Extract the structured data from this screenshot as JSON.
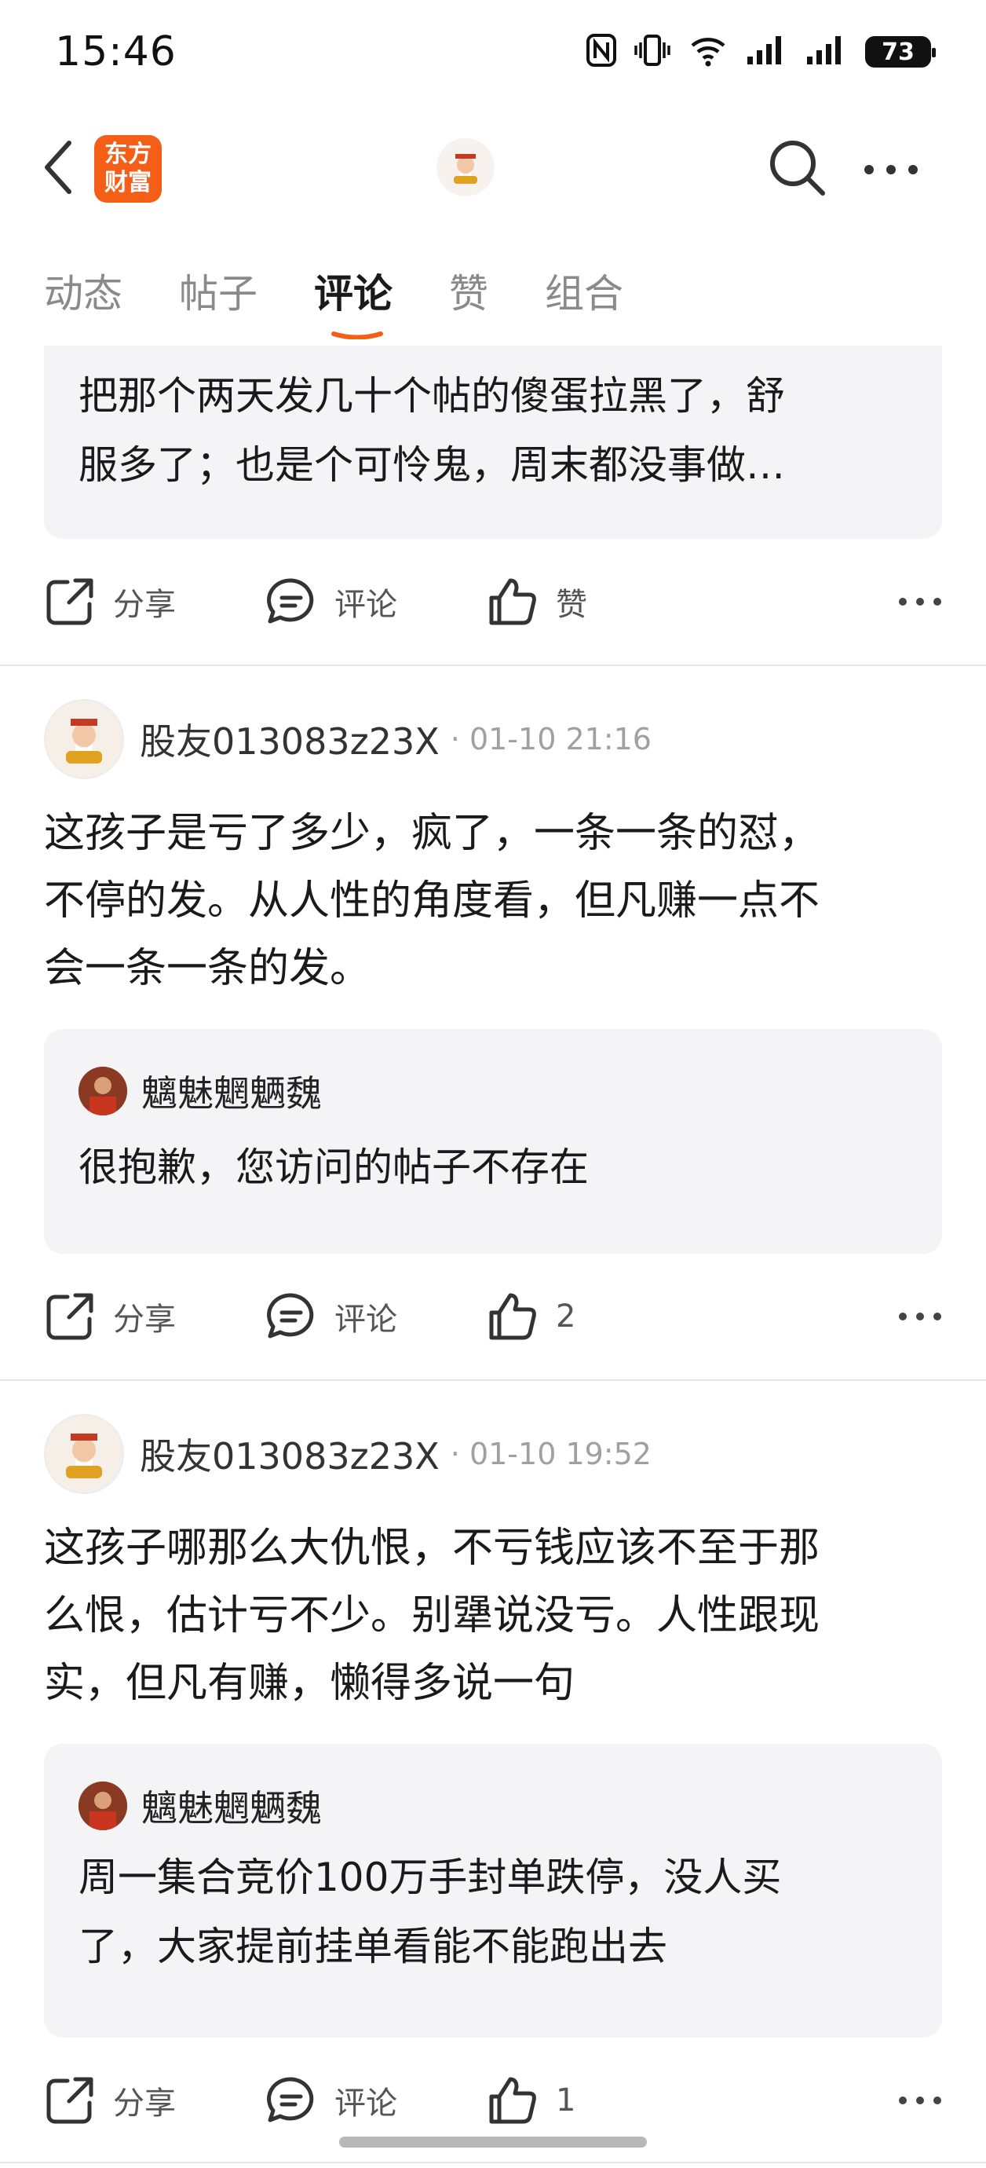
{
  "status_bar": {
    "time": "15:46",
    "battery": "73"
  },
  "header": {
    "logo_line1": "东方",
    "logo_line2": "财富"
  },
  "tabs": [
    {
      "label": "动态",
      "active": false
    },
    {
      "label": "帖子",
      "active": false
    },
    {
      "label": "评论",
      "active": true
    },
    {
      "label": "赞",
      "active": false
    },
    {
      "label": "组合",
      "active": false
    }
  ],
  "colors": {
    "accent": "#f55e16",
    "card_bg": "#f4f4f6",
    "muted": "#a0a0a0"
  },
  "top_card": {
    "quote_lines": [
      "把那个两天发几十个帖的傻蛋拉黑了，舒",
      "服多了；也是个可怜鬼，周末都没事做…"
    ],
    "actions": {
      "share": "分享",
      "comment": "评论",
      "like": "赞"
    }
  },
  "posts": [
    {
      "user": "股友013083z23X",
      "time": "· 01-10 21:16",
      "text_lines": [
        "这孩子是亏了多少，疯了，一条一条的怼，",
        "不停的发。从人性的角度看，但凡赚一点不",
        "会一条一条的发。"
      ],
      "reply_user": "魑魅魍魉魏",
      "reply_lines": [
        "很抱歉，您访问的帖子不存在"
      ],
      "actions": {
        "share": "分享",
        "comment": "评论",
        "like": "2"
      }
    },
    {
      "user": "股友013083z23X",
      "time": "· 01-10 19:52",
      "text_lines": [
        "这孩子哪那么大仇恨，不亏钱应该不至于那",
        "么恨，估计亏不少。别犟说没亏。人性跟现",
        "实，但凡有赚，懒得多说一句"
      ],
      "reply_user": "魑魅魍魉魏",
      "reply_lines": [
        "周一集合竞价100万手封单跌停，没人买",
        "了，大家提前挂单看能不能跑出去"
      ],
      "actions": {
        "share": "分享",
        "comment": "评论",
        "like": "1"
      }
    }
  ]
}
